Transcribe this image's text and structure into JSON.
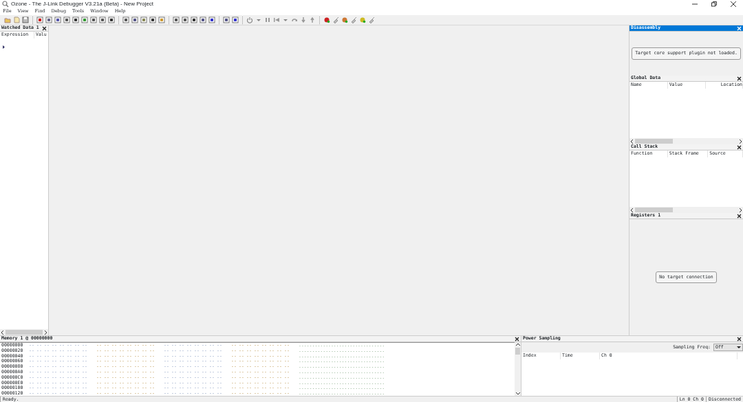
{
  "window": {
    "title": "Ozone - The J-Link Debugger V3.21a (Beta) - New Project"
  },
  "menu": [
    "File",
    "View",
    "Find",
    "Debug",
    "Tools",
    "Window",
    "Help"
  ],
  "panels": {
    "watched": {
      "title": "Watched Data 1",
      "active": false,
      "columns": [
        "Expression",
        "Valu"
      ]
    },
    "disassembly": {
      "title": "Disassembly",
      "active": true,
      "message": "Target core support plugin not loaded."
    },
    "global_data": {
      "title": "Global Data",
      "active": false,
      "columns": [
        "Name",
        "Value",
        "Location"
      ]
    },
    "call_stack": {
      "title": "Call Stack",
      "active": false,
      "columns": [
        "Function",
        "Stack Frame",
        "Source"
      ]
    },
    "registers": {
      "title": "Registers 1",
      "active": false,
      "message": "No target connection"
    },
    "memory": {
      "title": "Memory 1 @ 00000000",
      "active": false,
      "rows": [
        {
          "address": "00000000"
        },
        {
          "address": "00000020"
        },
        {
          "address": "00000040"
        },
        {
          "address": "00000060"
        },
        {
          "address": "00000080"
        },
        {
          "address": "000000A0"
        },
        {
          "address": "000000C0"
        },
        {
          "address": "000000E0"
        },
        {
          "address": "00000100"
        },
        {
          "address": "00000120"
        }
      ],
      "byte_placeholder": "--",
      "ascii_placeholder": "................................"
    },
    "power": {
      "title": "Power Sampling",
      "active": false,
      "freq_label": "Sampling Freq:",
      "freq_value": "Off",
      "columns": [
        "Index",
        "Time",
        "Ch 0"
      ]
    }
  },
  "status_bar": {
    "message": "Ready.",
    "position": "Ln 0  Ch 0",
    "connection": "Disconnected"
  }
}
